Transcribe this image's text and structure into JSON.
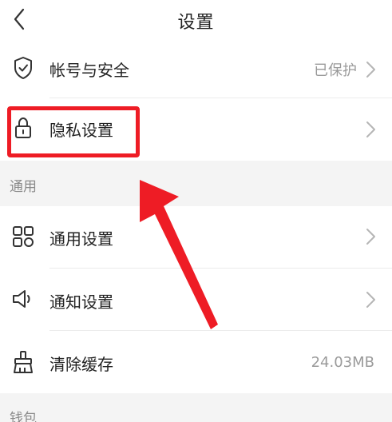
{
  "header": {
    "title": "设置"
  },
  "account": {
    "label": "帐号与安全",
    "value": "已保护"
  },
  "privacy": {
    "label": "隐私设置"
  },
  "general_section": {
    "title": "通用",
    "items": [
      {
        "label": "通用设置"
      },
      {
        "label": "通知设置"
      },
      {
        "label": "清除缓存",
        "value": "24.03MB"
      }
    ]
  },
  "wallet_section": {
    "title": "钱包"
  },
  "icons": {
    "back": "chevron-left-icon",
    "account": "shield-check-icon",
    "privacy": "lock-icon",
    "general": "grid-apps-icon",
    "notify": "speaker-icon",
    "cache": "broom-icon",
    "row_arrow": "chevron-right-icon"
  },
  "colors": {
    "highlight": "#ee1c25",
    "section_band": "#f4f4f4",
    "secondary_text": "#9a9a9a"
  }
}
